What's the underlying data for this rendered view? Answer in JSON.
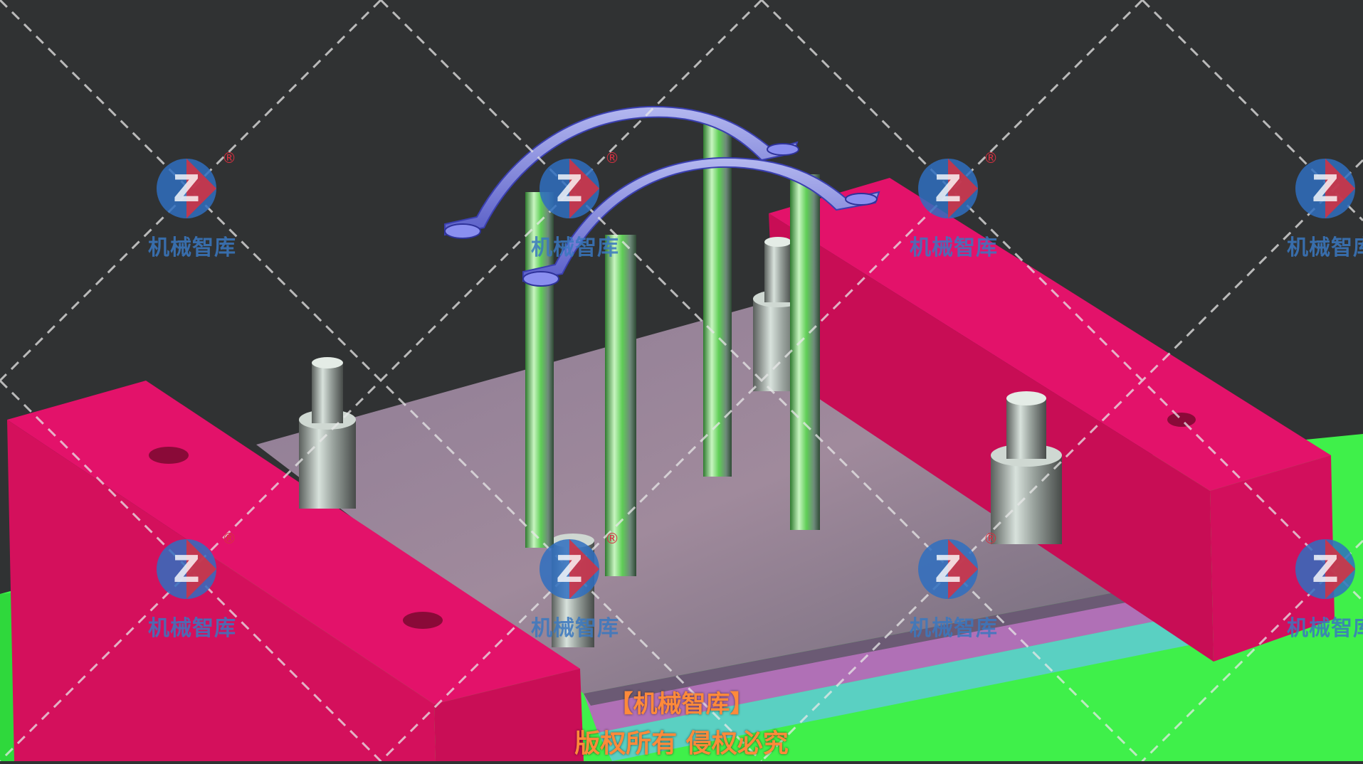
{
  "scene": {
    "description_colors": {
      "background": "#303233",
      "die_blocks": "#e0105e",
      "base_plate": "#3ff04a",
      "die_plate": "#9a7a92",
      "strip": "#5ad0c2",
      "guide_pins": "#9aa8a0",
      "bracket": "#7f7ff2"
    }
  },
  "watermark": {
    "brand_label": "机械智库",
    "registered_mark": "®"
  },
  "captions": {
    "line1": "【机械智库】",
    "line2": "版权所有 侵权必究"
  }
}
